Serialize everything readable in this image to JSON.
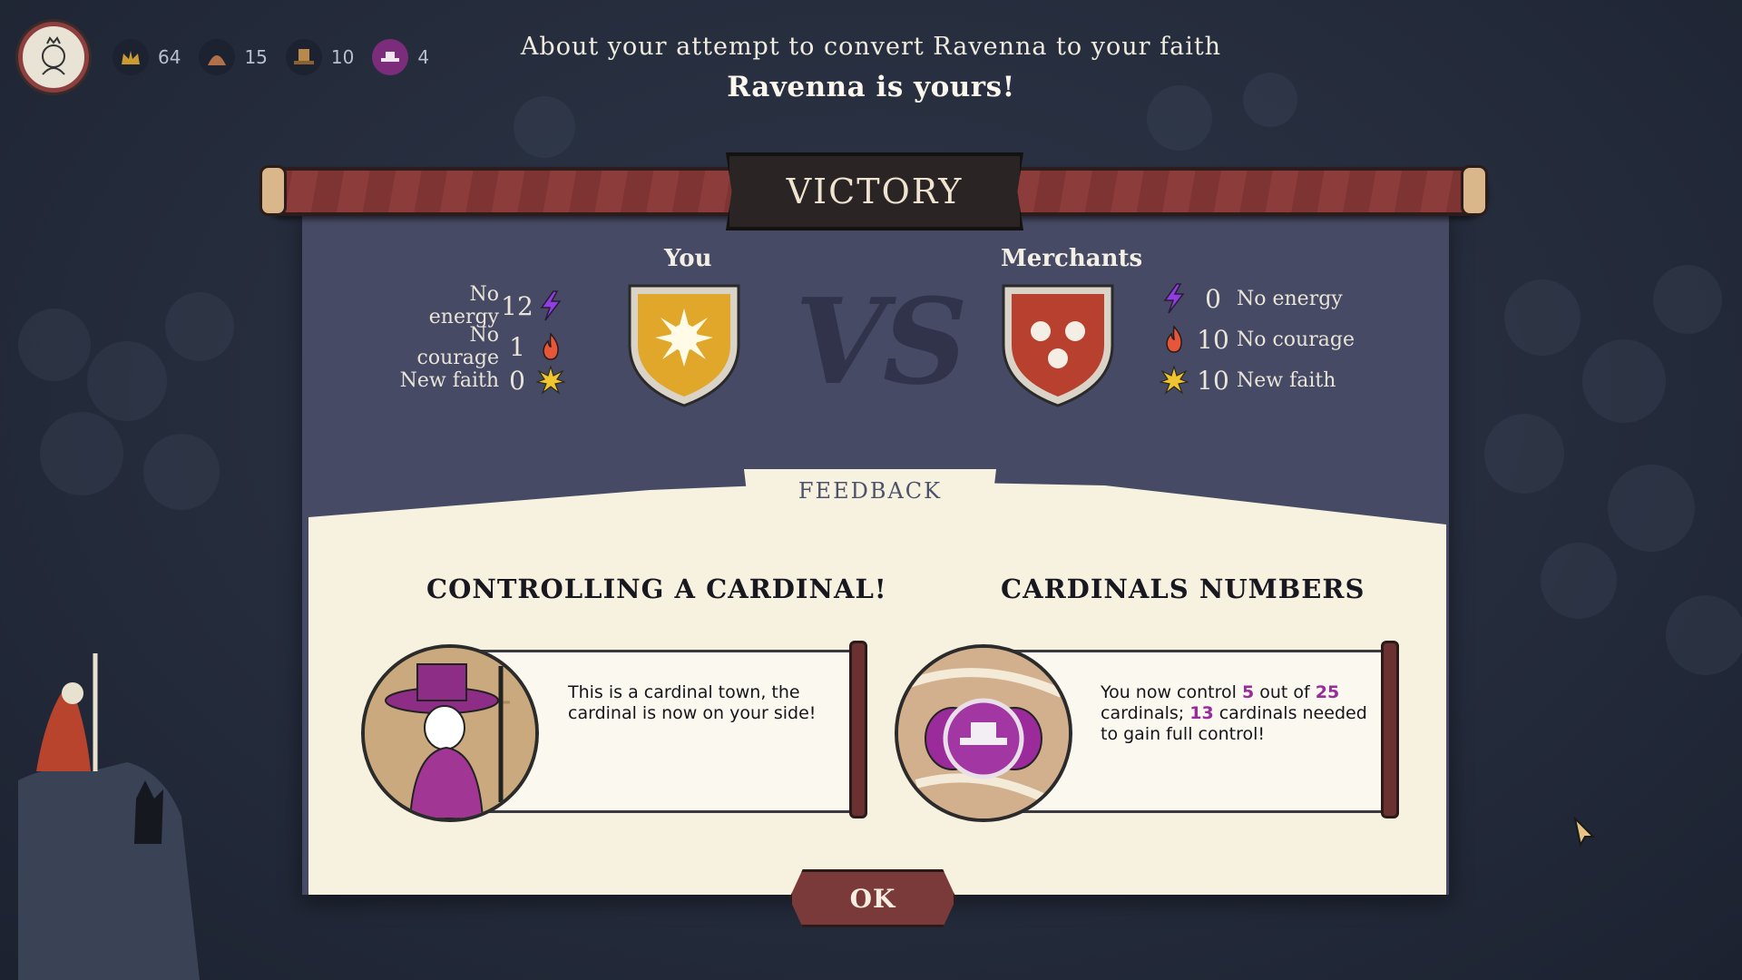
{
  "header": {
    "subtitle": "About your attempt to convert Ravenna to your faith",
    "title": "Ravenna is yours!"
  },
  "resources": [
    {
      "icon": "crown-icon",
      "value": "64"
    },
    {
      "icon": "helmet-icon",
      "value": "15"
    },
    {
      "icon": "hat-icon",
      "value": "10"
    },
    {
      "icon": "cardinal-hat-icon",
      "value": "4"
    }
  ],
  "banner": {
    "label": "VICTORY"
  },
  "you": {
    "name": "You",
    "stats": [
      {
        "label": "No energy",
        "value": "12",
        "icon": "lightning-icon"
      },
      {
        "label": "No courage",
        "value": "1",
        "icon": "flame-icon"
      },
      {
        "label": "New faith",
        "value": "0",
        "icon": "star-burst-icon"
      }
    ],
    "shield_color": "#e0a72a"
  },
  "versus": "VS",
  "opponent": {
    "name": "Merchants",
    "stats": [
      {
        "label": "No energy",
        "value": "0",
        "icon": "lightning-icon"
      },
      {
        "label": "No courage",
        "value": "10",
        "icon": "flame-icon"
      },
      {
        "label": "New faith",
        "value": "10",
        "icon": "star-burst-icon"
      }
    ],
    "shield_color": "#b8402e"
  },
  "feedback": {
    "tab_label": "FEEDBACK",
    "cards": [
      {
        "title": "CONTROLLING A CARDINAL!",
        "text": "This is a cardinal town, the cardinal is now on your side!"
      },
      {
        "title": "CARDINALS NUMBERS",
        "text_parts": [
          "You now control ",
          "5",
          " out of ",
          "25",
          " cardinals; ",
          "13",
          " cardinals needed to gain full control!"
        ]
      }
    ]
  },
  "ok_button": {
    "label": "OK"
  },
  "colors": {
    "accent_purple": "#9b2a9b",
    "panel": "#474a64",
    "parchment": "#f7f1e0",
    "button": "#7b3a3a"
  }
}
